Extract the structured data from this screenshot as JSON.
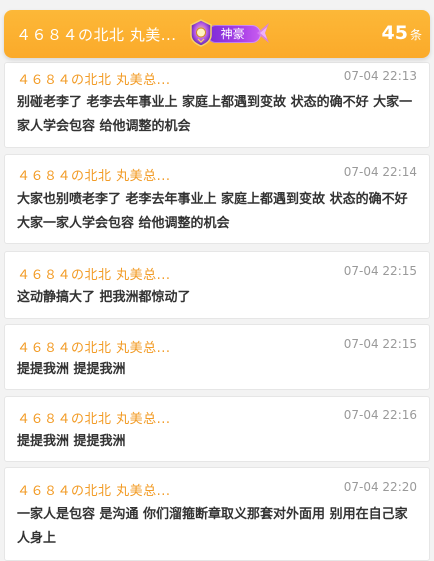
{
  "header": {
    "username": "４６８４の北北 丸美...",
    "badge_label": "神豪",
    "count": "45",
    "count_unit": "条"
  },
  "messages": [
    {
      "name": "４６８４の北北 丸美总...",
      "time": "07-04 22:13",
      "text": "别碰老李了 老李去年事业上 家庭上都遇到变故 状态的确不好 大家一家人学会包容 给他调整的机会"
    },
    {
      "name": "４６８４の北北 丸美总...",
      "time": "07-04 22:14",
      "text": "大家也别喷老李了 老李去年事业上 家庭上都遇到变故 状态的确不好 大家一家人学会包容 给他调整的机会"
    },
    {
      "name": "４６８４の北北 丸美总...",
      "time": "07-04 22:15",
      "text": "这动静搞大了 把我洲都惊动了"
    },
    {
      "name": "４６８４の北北 丸美总...",
      "time": "07-04 22:15",
      "text": "提提我洲 提提我洲"
    },
    {
      "name": "４６８４の北北 丸美总...",
      "time": "07-04 22:16",
      "text": "提提我洲 提提我洲"
    },
    {
      "name": "４６８４の北北 丸美总...",
      "time": "07-04 22:20",
      "text": "一家人是包容 是沟通 你们溜箍断章取义那套对外面用 别用在自己家人身上"
    }
  ]
}
